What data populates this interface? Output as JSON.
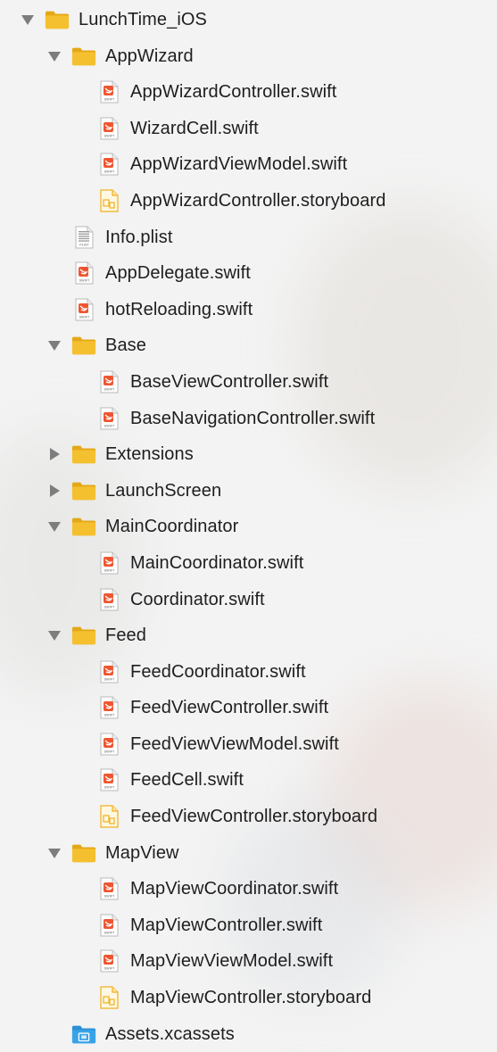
{
  "tree": [
    {
      "label": "LunchTime_iOS",
      "type": "folder",
      "depth": 0,
      "disclosure": "expanded",
      "icon": "folder-icon"
    },
    {
      "label": "AppWizard",
      "type": "folder",
      "depth": 1,
      "disclosure": "expanded",
      "icon": "folder-icon"
    },
    {
      "label": "AppWizardController.swift",
      "type": "swift",
      "depth": 2,
      "icon": "swift-file-icon"
    },
    {
      "label": "WizardCell.swift",
      "type": "swift",
      "depth": 2,
      "icon": "swift-file-icon"
    },
    {
      "label": "AppWizardViewModel.swift",
      "type": "swift",
      "depth": 2,
      "icon": "swift-file-icon"
    },
    {
      "label": "AppWizardController.storyboard",
      "type": "storyboard",
      "depth": 2,
      "icon": "storyboard-file-icon"
    },
    {
      "label": "Info.plist",
      "type": "plist",
      "depth": 1,
      "icon": "plist-file-icon"
    },
    {
      "label": "AppDelegate.swift",
      "type": "swift",
      "depth": 1,
      "icon": "swift-file-icon"
    },
    {
      "label": "hotReloading.swift",
      "type": "swift",
      "depth": 1,
      "icon": "swift-file-icon"
    },
    {
      "label": "Base",
      "type": "folder",
      "depth": 1,
      "disclosure": "expanded",
      "icon": "folder-icon"
    },
    {
      "label": "BaseViewController.swift",
      "type": "swift",
      "depth": 2,
      "icon": "swift-file-icon"
    },
    {
      "label": "BaseNavigationController.swift",
      "type": "swift",
      "depth": 2,
      "icon": "swift-file-icon"
    },
    {
      "label": "Extensions",
      "type": "folder",
      "depth": 1,
      "disclosure": "collapsed",
      "icon": "folder-icon"
    },
    {
      "label": "LaunchScreen",
      "type": "folder",
      "depth": 1,
      "disclosure": "collapsed",
      "icon": "folder-icon"
    },
    {
      "label": "MainCoordinator",
      "type": "folder",
      "depth": 1,
      "disclosure": "expanded",
      "icon": "folder-icon"
    },
    {
      "label": "MainCoordinator.swift",
      "type": "swift",
      "depth": 2,
      "icon": "swift-file-icon"
    },
    {
      "label": "Coordinator.swift",
      "type": "swift",
      "depth": 2,
      "icon": "swift-file-icon"
    },
    {
      "label": "Feed",
      "type": "folder",
      "depth": 1,
      "disclosure": "expanded",
      "icon": "folder-icon"
    },
    {
      "label": "FeedCoordinator.swift",
      "type": "swift",
      "depth": 2,
      "icon": "swift-file-icon"
    },
    {
      "label": "FeedViewController.swift",
      "type": "swift",
      "depth": 2,
      "icon": "swift-file-icon"
    },
    {
      "label": "FeedViewViewModel.swift",
      "type": "swift",
      "depth": 2,
      "icon": "swift-file-icon"
    },
    {
      "label": "FeedCell.swift",
      "type": "swift",
      "depth": 2,
      "icon": "swift-file-icon"
    },
    {
      "label": "FeedViewController.storyboard",
      "type": "storyboard",
      "depth": 2,
      "icon": "storyboard-file-icon"
    },
    {
      "label": "MapView",
      "type": "folder",
      "depth": 1,
      "disclosure": "expanded",
      "icon": "folder-icon"
    },
    {
      "label": "MapViewCoordinator.swift",
      "type": "swift",
      "depth": 2,
      "icon": "swift-file-icon"
    },
    {
      "label": "MapViewController.swift",
      "type": "swift",
      "depth": 2,
      "icon": "swift-file-icon"
    },
    {
      "label": "MapViewViewModel.swift",
      "type": "swift",
      "depth": 2,
      "icon": "swift-file-icon"
    },
    {
      "label": "MapViewController.storyboard",
      "type": "storyboard",
      "depth": 2,
      "icon": "storyboard-file-icon"
    },
    {
      "label": "Assets.xcassets",
      "type": "assets",
      "depth": 1,
      "icon": "asset-catalog-icon"
    }
  ],
  "file_badges": {
    "swift": "SWIFT",
    "plist": "PLIST"
  },
  "colors": {
    "folder": "#f5c030",
    "folder_dark": "#e4a816",
    "swift": "#ef5530",
    "disclosure": "#7d7d7d",
    "assets": "#38a3e8",
    "storyboard": "#f0b021"
  }
}
